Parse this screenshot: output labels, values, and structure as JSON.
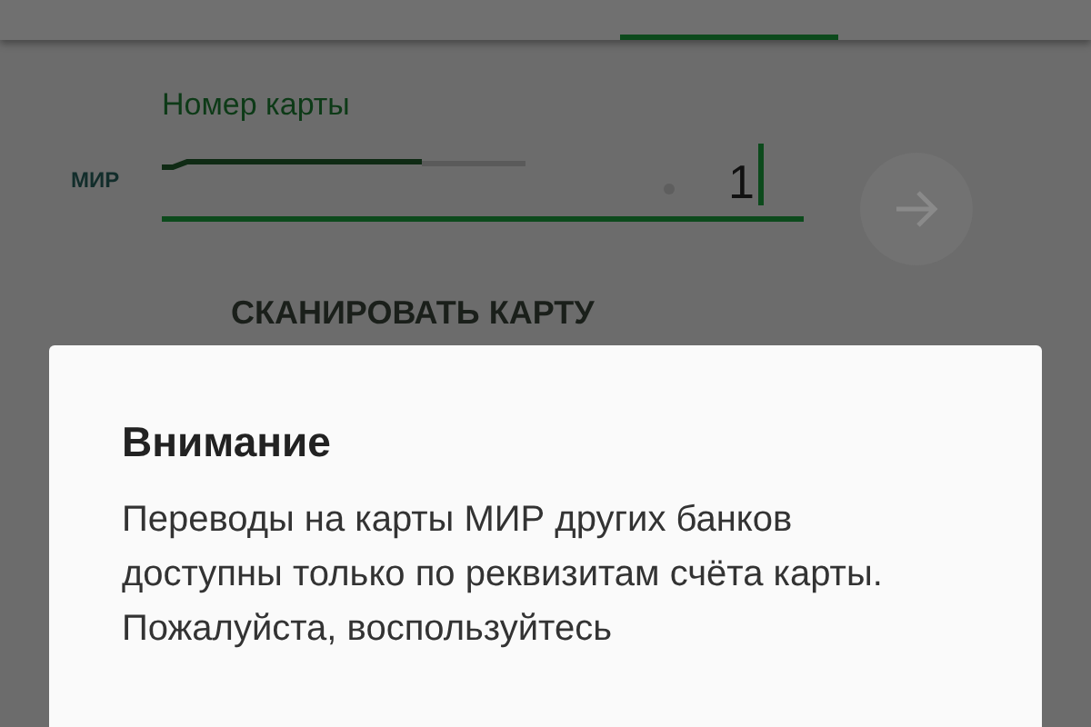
{
  "card_form": {
    "logo": "МИР",
    "label": "Номер карты",
    "value": "1",
    "scan_button": "СКАНИРОВАТЬ КАРТУ"
  },
  "dialog": {
    "title": "Внимание",
    "message": "Переводы на карты МИР других банков доступны только по реквизитам счёта карты. Пожалуйста, воспользуйтесь"
  }
}
